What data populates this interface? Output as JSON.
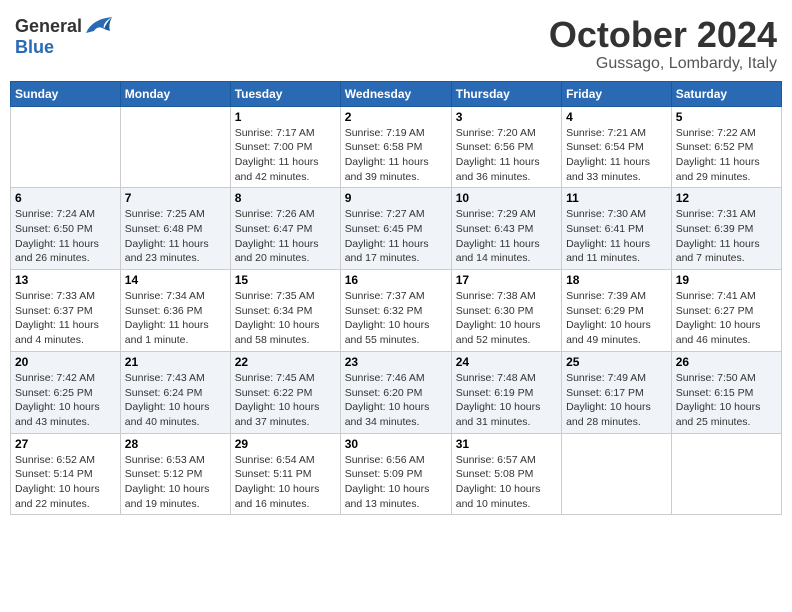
{
  "header": {
    "logo_general": "General",
    "logo_blue": "Blue",
    "month_title": "October 2024",
    "location": "Gussago, Lombardy, Italy"
  },
  "calendar": {
    "days_of_week": [
      "Sunday",
      "Monday",
      "Tuesday",
      "Wednesday",
      "Thursday",
      "Friday",
      "Saturday"
    ],
    "weeks": [
      [
        {
          "day": "",
          "info": ""
        },
        {
          "day": "",
          "info": ""
        },
        {
          "day": "1",
          "info": "Sunrise: 7:17 AM\nSunset: 7:00 PM\nDaylight: 11 hours and 42 minutes."
        },
        {
          "day": "2",
          "info": "Sunrise: 7:19 AM\nSunset: 6:58 PM\nDaylight: 11 hours and 39 minutes."
        },
        {
          "day": "3",
          "info": "Sunrise: 7:20 AM\nSunset: 6:56 PM\nDaylight: 11 hours and 36 minutes."
        },
        {
          "day": "4",
          "info": "Sunrise: 7:21 AM\nSunset: 6:54 PM\nDaylight: 11 hours and 33 minutes."
        },
        {
          "day": "5",
          "info": "Sunrise: 7:22 AM\nSunset: 6:52 PM\nDaylight: 11 hours and 29 minutes."
        }
      ],
      [
        {
          "day": "6",
          "info": "Sunrise: 7:24 AM\nSunset: 6:50 PM\nDaylight: 11 hours and 26 minutes."
        },
        {
          "day": "7",
          "info": "Sunrise: 7:25 AM\nSunset: 6:48 PM\nDaylight: 11 hours and 23 minutes."
        },
        {
          "day": "8",
          "info": "Sunrise: 7:26 AM\nSunset: 6:47 PM\nDaylight: 11 hours and 20 minutes."
        },
        {
          "day": "9",
          "info": "Sunrise: 7:27 AM\nSunset: 6:45 PM\nDaylight: 11 hours and 17 minutes."
        },
        {
          "day": "10",
          "info": "Sunrise: 7:29 AM\nSunset: 6:43 PM\nDaylight: 11 hours and 14 minutes."
        },
        {
          "day": "11",
          "info": "Sunrise: 7:30 AM\nSunset: 6:41 PM\nDaylight: 11 hours and 11 minutes."
        },
        {
          "day": "12",
          "info": "Sunrise: 7:31 AM\nSunset: 6:39 PM\nDaylight: 11 hours and 7 minutes."
        }
      ],
      [
        {
          "day": "13",
          "info": "Sunrise: 7:33 AM\nSunset: 6:37 PM\nDaylight: 11 hours and 4 minutes."
        },
        {
          "day": "14",
          "info": "Sunrise: 7:34 AM\nSunset: 6:36 PM\nDaylight: 11 hours and 1 minute."
        },
        {
          "day": "15",
          "info": "Sunrise: 7:35 AM\nSunset: 6:34 PM\nDaylight: 10 hours and 58 minutes."
        },
        {
          "day": "16",
          "info": "Sunrise: 7:37 AM\nSunset: 6:32 PM\nDaylight: 10 hours and 55 minutes."
        },
        {
          "day": "17",
          "info": "Sunrise: 7:38 AM\nSunset: 6:30 PM\nDaylight: 10 hours and 52 minutes."
        },
        {
          "day": "18",
          "info": "Sunrise: 7:39 AM\nSunset: 6:29 PM\nDaylight: 10 hours and 49 minutes."
        },
        {
          "day": "19",
          "info": "Sunrise: 7:41 AM\nSunset: 6:27 PM\nDaylight: 10 hours and 46 minutes."
        }
      ],
      [
        {
          "day": "20",
          "info": "Sunrise: 7:42 AM\nSunset: 6:25 PM\nDaylight: 10 hours and 43 minutes."
        },
        {
          "day": "21",
          "info": "Sunrise: 7:43 AM\nSunset: 6:24 PM\nDaylight: 10 hours and 40 minutes."
        },
        {
          "day": "22",
          "info": "Sunrise: 7:45 AM\nSunset: 6:22 PM\nDaylight: 10 hours and 37 minutes."
        },
        {
          "day": "23",
          "info": "Sunrise: 7:46 AM\nSunset: 6:20 PM\nDaylight: 10 hours and 34 minutes."
        },
        {
          "day": "24",
          "info": "Sunrise: 7:48 AM\nSunset: 6:19 PM\nDaylight: 10 hours and 31 minutes."
        },
        {
          "day": "25",
          "info": "Sunrise: 7:49 AM\nSunset: 6:17 PM\nDaylight: 10 hours and 28 minutes."
        },
        {
          "day": "26",
          "info": "Sunrise: 7:50 AM\nSunset: 6:15 PM\nDaylight: 10 hours and 25 minutes."
        }
      ],
      [
        {
          "day": "27",
          "info": "Sunrise: 6:52 AM\nSunset: 5:14 PM\nDaylight: 10 hours and 22 minutes."
        },
        {
          "day": "28",
          "info": "Sunrise: 6:53 AM\nSunset: 5:12 PM\nDaylight: 10 hours and 19 minutes."
        },
        {
          "day": "29",
          "info": "Sunrise: 6:54 AM\nSunset: 5:11 PM\nDaylight: 10 hours and 16 minutes."
        },
        {
          "day": "30",
          "info": "Sunrise: 6:56 AM\nSunset: 5:09 PM\nDaylight: 10 hours and 13 minutes."
        },
        {
          "day": "31",
          "info": "Sunrise: 6:57 AM\nSunset: 5:08 PM\nDaylight: 10 hours and 10 minutes."
        },
        {
          "day": "",
          "info": ""
        },
        {
          "day": "",
          "info": ""
        }
      ]
    ]
  }
}
